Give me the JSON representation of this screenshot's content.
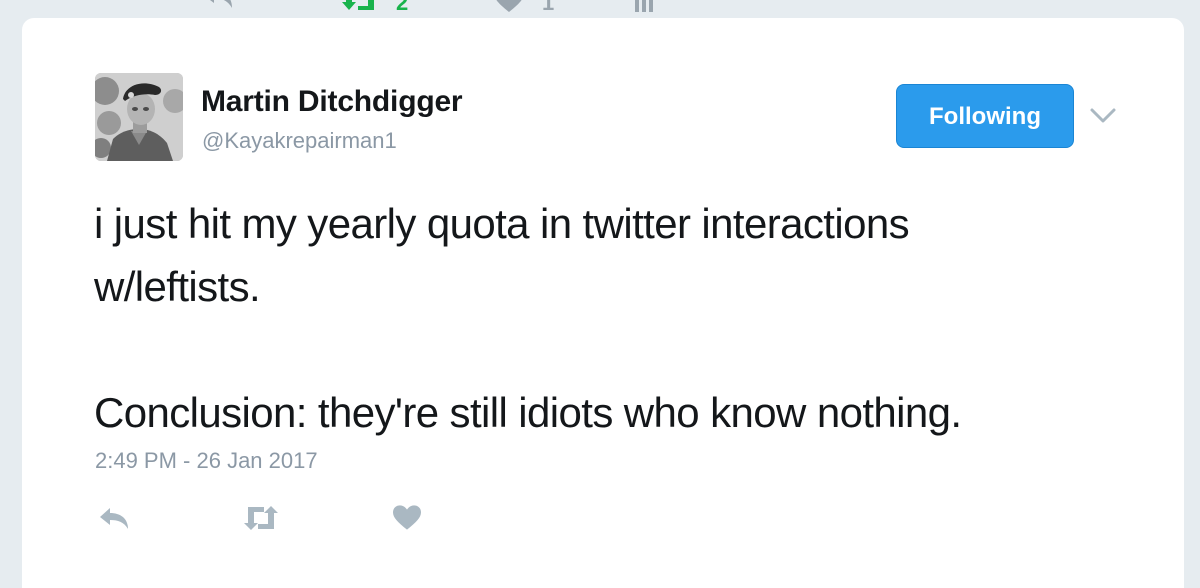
{
  "previous_tweet": {
    "retweet_count": "2",
    "like_count": "1"
  },
  "tweet": {
    "author": {
      "display_name": "Martin Ditchdigger",
      "handle": "@Kayakrepairman1"
    },
    "follow_button_label": "Following",
    "text_lines": [
      "i just hit my yearly quota in twitter interactions",
      "w/leftists.",
      "Conclusion: they're still idiots who know nothing."
    ],
    "timestamp": "2:49 PM - 26 Jan 2017",
    "actions": [
      {
        "name": "reply",
        "icon": "reply-icon"
      },
      {
        "name": "retweet",
        "icon": "retweet-icon"
      },
      {
        "name": "like",
        "icon": "heart-icon"
      }
    ]
  },
  "colors": {
    "accent": "#2b9bec",
    "text": "#14171a",
    "muted": "#8b98a5",
    "background": "#e6ecf0"
  }
}
